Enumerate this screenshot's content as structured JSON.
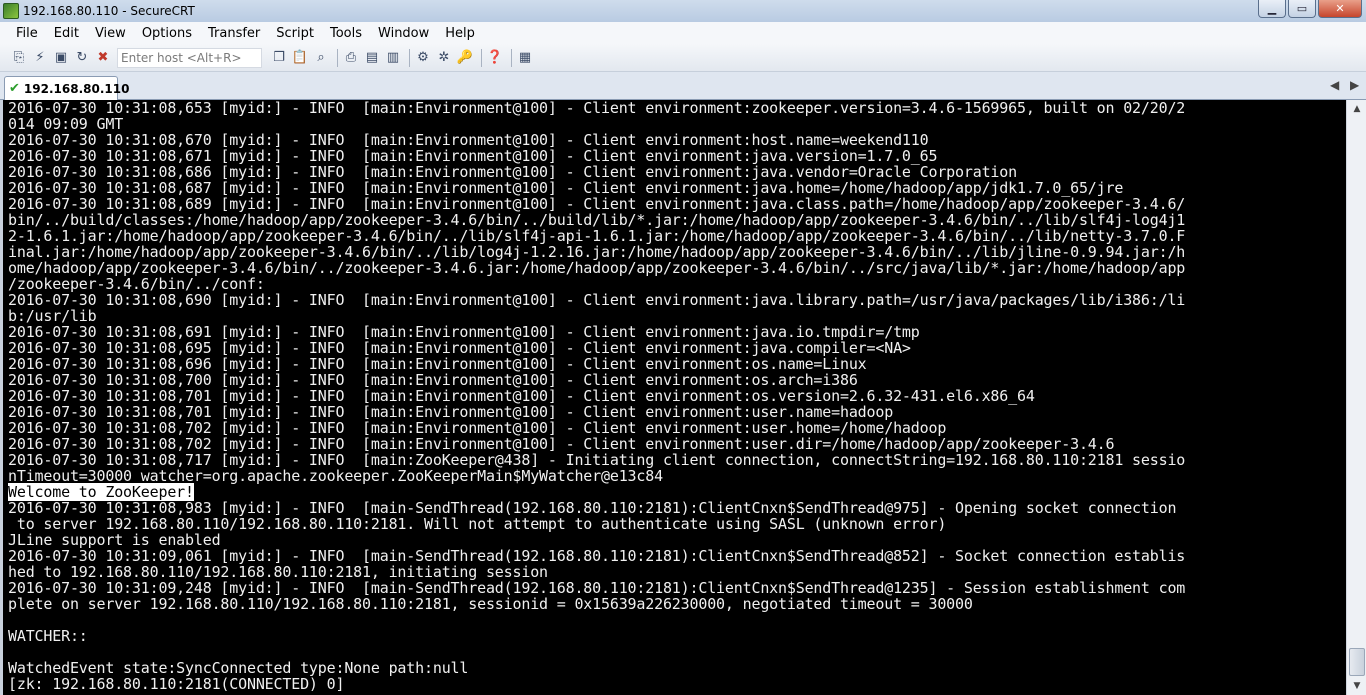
{
  "window": {
    "title": "192.168.80.110 - SecureCRT",
    "controls": {
      "minimize": "▁",
      "maximize": "▭",
      "close": "✕"
    }
  },
  "menu": [
    "File",
    "Edit",
    "View",
    "Options",
    "Transfer",
    "Script",
    "Tools",
    "Window",
    "Help"
  ],
  "toolbar": {
    "host_placeholder": "Enter host <Alt+R>",
    "buttons_left": [
      "connect-icon",
      "quick-connect-icon",
      "connect-tab-icon",
      "reconnect-icon",
      "disconnect-icon"
    ],
    "buttons_right": [
      "copy-icon",
      "paste-icon",
      "find-icon",
      "print-icon",
      "print-screen-icon",
      "print-setup-icon",
      "session-options-icon",
      "global-options-icon",
      "keymap-icon",
      "help-icon",
      "sftp-icon"
    ]
  },
  "tabs": [
    {
      "label": "192.168.80.110",
      "status": "connected"
    }
  ],
  "terminal": {
    "lines": [
      "2016-07-30 10:31:08,653 [myid:] - INFO  [main:Environment@100] - Client environment:zookeeper.version=3.4.6-1569965, built on 02/20/2",
      "014 09:09 GMT",
      "2016-07-30 10:31:08,670 [myid:] - INFO  [main:Environment@100] - Client environment:host.name=weekend110",
      "2016-07-30 10:31:08,671 [myid:] - INFO  [main:Environment@100] - Client environment:java.version=1.7.0_65",
      "2016-07-30 10:31:08,686 [myid:] - INFO  [main:Environment@100] - Client environment:java.vendor=Oracle Corporation",
      "2016-07-30 10:31:08,687 [myid:] - INFO  [main:Environment@100] - Client environment:java.home=/home/hadoop/app/jdk1.7.0_65/jre",
      "2016-07-30 10:31:08,689 [myid:] - INFO  [main:Environment@100] - Client environment:java.class.path=/home/hadoop/app/zookeeper-3.4.6/",
      "bin/../build/classes:/home/hadoop/app/zookeeper-3.4.6/bin/../build/lib/*.jar:/home/hadoop/app/zookeeper-3.4.6/bin/../lib/slf4j-log4j1",
      "2-1.6.1.jar:/home/hadoop/app/zookeeper-3.4.6/bin/../lib/slf4j-api-1.6.1.jar:/home/hadoop/app/zookeeper-3.4.6/bin/../lib/netty-3.7.0.F",
      "inal.jar:/home/hadoop/app/zookeeper-3.4.6/bin/../lib/log4j-1.2.16.jar:/home/hadoop/app/zookeeper-3.4.6/bin/../lib/jline-0.9.94.jar:/h",
      "ome/hadoop/app/zookeeper-3.4.6/bin/../zookeeper-3.4.6.jar:/home/hadoop/app/zookeeper-3.4.6/bin/../src/java/lib/*.jar:/home/hadoop/app",
      "/zookeeper-3.4.6/bin/../conf:",
      "2016-07-30 10:31:08,690 [myid:] - INFO  [main:Environment@100] - Client environment:java.library.path=/usr/java/packages/lib/i386:/li",
      "b:/usr/lib",
      "2016-07-30 10:31:08,691 [myid:] - INFO  [main:Environment@100] - Client environment:java.io.tmpdir=/tmp",
      "2016-07-30 10:31:08,695 [myid:] - INFO  [main:Environment@100] - Client environment:java.compiler=<NA>",
      "2016-07-30 10:31:08,696 [myid:] - INFO  [main:Environment@100] - Client environment:os.name=Linux",
      "2016-07-30 10:31:08,700 [myid:] - INFO  [main:Environment@100] - Client environment:os.arch=i386",
      "2016-07-30 10:31:08,701 [myid:] - INFO  [main:Environment@100] - Client environment:os.version=2.6.32-431.el6.x86_64",
      "2016-07-30 10:31:08,701 [myid:] - INFO  [main:Environment@100] - Client environment:user.name=hadoop",
      "2016-07-30 10:31:08,702 [myid:] - INFO  [main:Environment@100] - Client environment:user.home=/home/hadoop",
      "2016-07-30 10:31:08,702 [myid:] - INFO  [main:Environment@100] - Client environment:user.dir=/home/hadoop/app/zookeeper-3.4.6",
      "2016-07-30 10:31:08,717 [myid:] - INFO  [main:ZooKeeper@438] - Initiating client connection, connectString=192.168.80.110:2181 sessio",
      "nTimeout=30000 watcher=org.apache.zookeeper.ZooKeeperMain$MyWatcher@e13c84",
      "Welcome to ZooKeeper!",
      "2016-07-30 10:31:08,983 [myid:] - INFO  [main-SendThread(192.168.80.110:2181):ClientCnxn$SendThread@975] - Opening socket connection",
      " to server 192.168.80.110/192.168.80.110:2181. Will not attempt to authenticate using SASL (unknown error)",
      "JLine support is enabled",
      "2016-07-30 10:31:09,061 [myid:] - INFO  [main-SendThread(192.168.80.110:2181):ClientCnxn$SendThread@852] - Socket connection establis",
      "hed to 192.168.80.110/192.168.80.110:2181, initiating session",
      "2016-07-30 10:31:09,248 [myid:] - INFO  [main-SendThread(192.168.80.110:2181):ClientCnxn$SendThread@1235] - Session establishment com",
      "plete on server 192.168.80.110/192.168.80.110:2181, sessionid = 0x15639a226230000, negotiated timeout = 30000",
      "",
      "WATCHER::",
      "",
      "WatchedEvent state:SyncConnected type:None path:null",
      "[zk: 192.168.80.110:2181(CONNECTED) 0]"
    ],
    "highlighted_line_index": 24
  }
}
